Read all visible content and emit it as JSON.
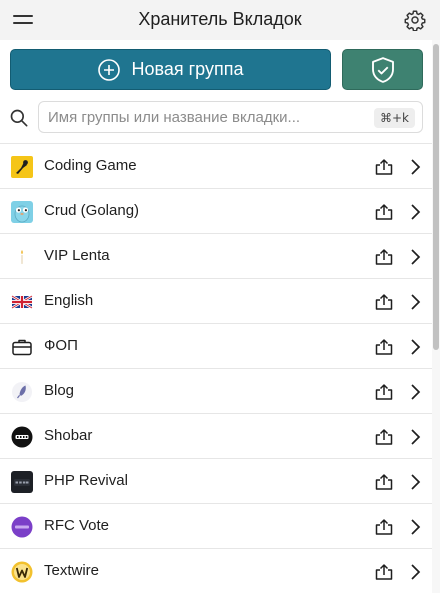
{
  "header": {
    "title": "Хранитель Вкладок",
    "menu_icon": "hamburger-icon",
    "settings_icon": "gear-icon"
  },
  "actions": {
    "new_group_label": "Новая группа",
    "new_group_icon": "plus-circle-icon",
    "shield_icon": "shield-check-icon"
  },
  "search": {
    "placeholder": "Имя группы или название вкладки...",
    "shortcut": "⌘+k"
  },
  "colors": {
    "primary": "#1f7590",
    "secondary": "#3e8271",
    "header_bg": "#f3f3f3"
  },
  "groups": [
    {
      "name": "Coding Game",
      "icon": "codingame-icon"
    },
    {
      "name": "Crud (Golang)",
      "icon": "gopher-icon"
    },
    {
      "name": "VIP Lenta",
      "icon": "candle-icon"
    },
    {
      "name": "English",
      "icon": "uk-flag-icon"
    },
    {
      "name": "ФОП",
      "icon": "briefcase-icon"
    },
    {
      "name": "Blog",
      "icon": "feather-icon"
    },
    {
      "name": "Shobar",
      "icon": "shobar-icon"
    },
    {
      "name": "PHP Revival",
      "icon": "php-icon"
    },
    {
      "name": "RFC Vote",
      "icon": "rfc-icon"
    },
    {
      "name": "Textwire",
      "icon": "textwire-icon"
    }
  ]
}
